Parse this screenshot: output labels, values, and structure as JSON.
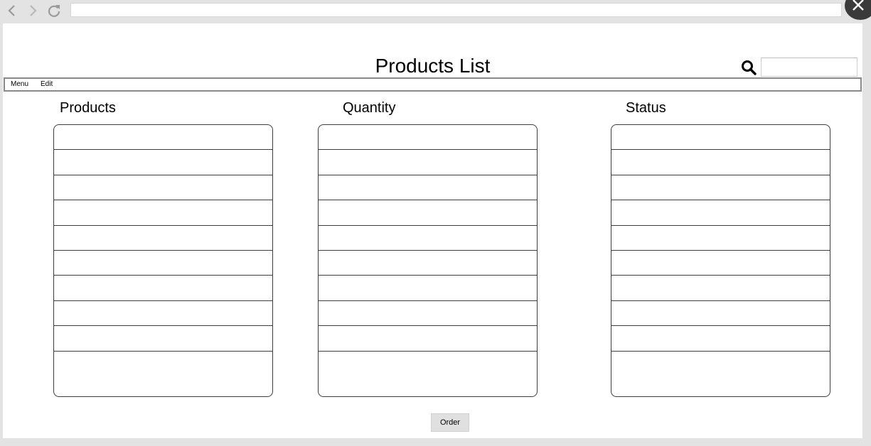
{
  "browser": {
    "back_icon": "chevron-left-icon",
    "forward_icon": "chevron-right-icon",
    "reload_icon": "reload-icon",
    "close_icon": "close-icon",
    "address": ""
  },
  "header": {
    "title": "Products List",
    "search_icon": "search-icon",
    "search_value": ""
  },
  "menubar": {
    "items": [
      {
        "label": "Menu"
      },
      {
        "label": "Edit"
      }
    ]
  },
  "columns": [
    {
      "header": "Products",
      "rows": [
        "",
        "",
        "",
        "",
        "",
        "",
        "",
        "",
        "",
        ""
      ]
    },
    {
      "header": "Quantity",
      "rows": [
        "",
        "",
        "",
        "",
        "",
        "",
        "",
        "",
        "",
        ""
      ]
    },
    {
      "header": "Status",
      "rows": [
        "",
        "",
        "",
        "",
        "",
        "",
        "",
        "",
        "",
        ""
      ]
    }
  ],
  "footer": {
    "order_label": "Order"
  },
  "colors": {
    "chrome_bg": "#e3e3e3",
    "page_bg": "#ffffff",
    "border": "#3d3d3d",
    "button_bg": "#e0e0e0"
  }
}
